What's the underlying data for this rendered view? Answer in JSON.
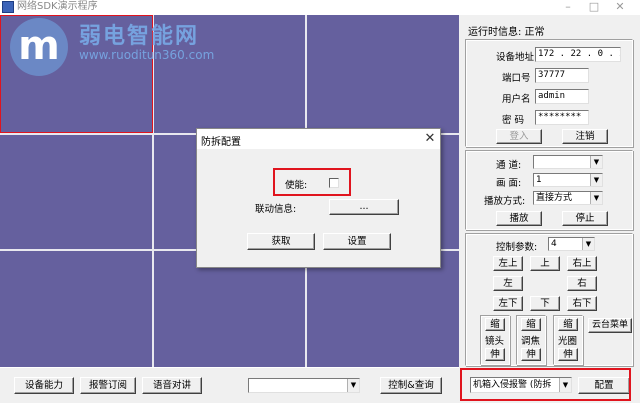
{
  "window": {
    "title": "网络SDK演示程序"
  },
  "watermark": {
    "logo_letter": "m",
    "text": "弱电智能网",
    "url": "www.ruoditun360.com"
  },
  "right_panel": {
    "status_label": "运行时信息: 正常",
    "login": {
      "ip_label": "设备地址",
      "ip_value": "172 . 22  . 0  . 226",
      "port_label": "端口号",
      "port_value": "37777",
      "user_label": "用户名",
      "user_value": "admin",
      "pwd_label": "密    码",
      "pwd_value": "********",
      "login_button": "登入",
      "logout_button": "注销"
    },
    "play": {
      "channel_label": "通    道:",
      "channel_value": "",
      "screen_label": "画    面:",
      "screen_value": "1",
      "mode_label": "播放方式:",
      "mode_value": "直接方式",
      "play_button": "播放",
      "stop_button": "停止"
    },
    "ptz": {
      "param_label": "控制参数:",
      "param_value": "4",
      "up_left": "左上",
      "up": "上",
      "up_right": "右上",
      "left": "左",
      "right": "右",
      "down_left": "左下",
      "down": "下",
      "down_right": "右下",
      "zoom_in": "缩",
      "zoom_out": "伸",
      "lens_label": "镜头",
      "focus_in": "缩",
      "focus_out": "伸",
      "focus_label": "调焦",
      "iris_in": "缩",
      "iris_out": "伸",
      "iris_label": "光圈",
      "menu_button": "云台菜单"
    }
  },
  "bottom_bar": {
    "capability_button": "设备能力",
    "alarm_sub_button": "报警订阅",
    "talk_button": "语音对讲",
    "select_value": "",
    "control_query_button": "控制&查询",
    "alarm_type_value": "机箱入侵报警 (防拆",
    "config_button": "配置"
  },
  "dialog": {
    "title": "防拆配置",
    "close": "✕",
    "enable_label": "使能:",
    "link_label": "联动信息:",
    "link_button": "...",
    "get_button": "获取",
    "set_button": "设置"
  },
  "colors": {
    "video_bg": "#65609e",
    "highlight": "#e0141e"
  }
}
